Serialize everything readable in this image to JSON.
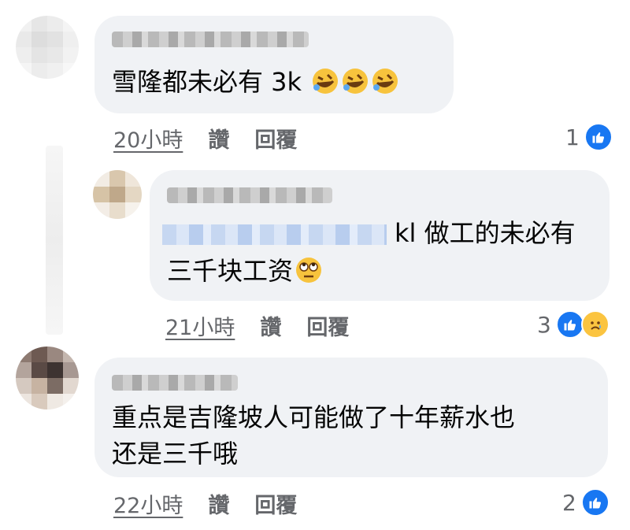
{
  "comments": [
    {
      "text": "雪隆都未必有 3k",
      "emojis": [
        "rolling-on-floor-laughing",
        "rolling-on-floor-laughing",
        "rolling-on-floor-laughing"
      ],
      "time": "20小時",
      "like_label": "讚",
      "reply_label": "回覆",
      "reaction_count": "1",
      "reactions": [
        "like"
      ]
    },
    {
      "is_reply": true,
      "text_line1": "kl 做工的未必有",
      "text_line2": "三千块工资",
      "emojis": [
        "face-with-rolling-eyes"
      ],
      "time": "21小時",
      "like_label": "讚",
      "reply_label": "回覆",
      "reaction_count": "3",
      "reactions": [
        "like",
        "sad"
      ]
    },
    {
      "text_line1": "重点是吉隆坡人可能做了十年薪水也",
      "text_line2": "还是三千哦",
      "time": "22小時",
      "like_label": "讚",
      "reply_label": "回覆",
      "reaction_count": "2",
      "reactions": [
        "like"
      ]
    }
  ],
  "colors": {
    "bubble": "#f0f2f5",
    "meta": "#65676b",
    "like_blue": "#1877f2",
    "sad_yellow": "#fbc440"
  }
}
